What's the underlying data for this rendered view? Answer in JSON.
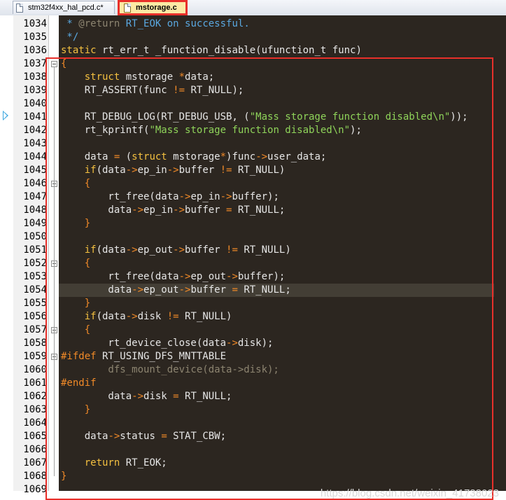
{
  "tabs": [
    {
      "label": "stm32f4xx_hal_pcd.c*",
      "active": false
    },
    {
      "label": "mstorage.c",
      "active": true
    }
  ],
  "editor": {
    "current_line": 1041,
    "highlighted_line": 1054,
    "lines": [
      {
        "num": "1034",
        "fold": false,
        "segs": [
          [
            "cmt",
            " * "
          ],
          [
            "dim",
            "@return"
          ],
          [
            "cmt",
            " RT_EOK on successful."
          ]
        ]
      },
      {
        "num": "1035",
        "fold": false,
        "segs": [
          [
            "cmt",
            " */"
          ]
        ]
      },
      {
        "num": "1036",
        "fold": false,
        "segs": [
          [
            "kw",
            "static"
          ],
          [
            "txt",
            " rt_err_t _function_disable(ufunction_t func)"
          ]
        ]
      },
      {
        "num": "1037",
        "fold": true,
        "segs": [
          [
            "op",
            "{"
          ]
        ]
      },
      {
        "num": "1038",
        "fold": false,
        "segs": [
          [
            "txt",
            "    "
          ],
          [
            "kw",
            "struct"
          ],
          [
            "txt",
            " mstorage "
          ],
          [
            "op",
            "*"
          ],
          [
            "txt",
            "data;"
          ]
        ]
      },
      {
        "num": "1039",
        "fold": false,
        "segs": [
          [
            "txt",
            "    RT_ASSERT(func "
          ],
          [
            "op",
            "!="
          ],
          [
            "txt",
            " RT_NULL);"
          ]
        ]
      },
      {
        "num": "1040",
        "fold": false,
        "segs": [
          [
            "txt",
            ""
          ]
        ]
      },
      {
        "num": "1041",
        "fold": false,
        "segs": [
          [
            "txt",
            "    RT_DEBUG_LOG(RT_DEBUG_USB, ("
          ],
          [
            "str",
            "\"Mass storage function disabled\\n\""
          ],
          [
            "txt",
            "));"
          ]
        ]
      },
      {
        "num": "1042",
        "fold": false,
        "segs": [
          [
            "txt",
            "    rt_kprintf("
          ],
          [
            "str",
            "\"Mass storage function disabled\\n\""
          ],
          [
            "txt",
            ");"
          ]
        ]
      },
      {
        "num": "1043",
        "fold": false,
        "segs": [
          [
            "txt",
            ""
          ]
        ]
      },
      {
        "num": "1044",
        "fold": false,
        "segs": [
          [
            "txt",
            "    data "
          ],
          [
            "op",
            "="
          ],
          [
            "txt",
            " ("
          ],
          [
            "kw",
            "struct"
          ],
          [
            "txt",
            " mstorage"
          ],
          [
            "op",
            "*"
          ],
          [
            "txt",
            ")func"
          ],
          [
            "op",
            "->"
          ],
          [
            "txt",
            "user_data;"
          ]
        ]
      },
      {
        "num": "1045",
        "fold": false,
        "segs": [
          [
            "txt",
            "    "
          ],
          [
            "kw",
            "if"
          ],
          [
            "txt",
            "(data"
          ],
          [
            "op",
            "->"
          ],
          [
            "txt",
            "ep_in"
          ],
          [
            "op",
            "->"
          ],
          [
            "txt",
            "buffer "
          ],
          [
            "op",
            "!="
          ],
          [
            "txt",
            " RT_NULL)"
          ]
        ]
      },
      {
        "num": "1046",
        "fold": true,
        "segs": [
          [
            "txt",
            "    "
          ],
          [
            "op",
            "{"
          ]
        ]
      },
      {
        "num": "1047",
        "fold": false,
        "segs": [
          [
            "txt",
            "        rt_free(data"
          ],
          [
            "op",
            "->"
          ],
          [
            "txt",
            "ep_in"
          ],
          [
            "op",
            "->"
          ],
          [
            "txt",
            "buffer);"
          ]
        ]
      },
      {
        "num": "1048",
        "fold": false,
        "segs": [
          [
            "txt",
            "        data"
          ],
          [
            "op",
            "->"
          ],
          [
            "txt",
            "ep_in"
          ],
          [
            "op",
            "->"
          ],
          [
            "txt",
            "buffer "
          ],
          [
            "op",
            "="
          ],
          [
            "txt",
            " RT_NULL;"
          ]
        ]
      },
      {
        "num": "1049",
        "fold": false,
        "segs": [
          [
            "txt",
            "    "
          ],
          [
            "op",
            "}"
          ]
        ]
      },
      {
        "num": "1050",
        "fold": false,
        "segs": [
          [
            "txt",
            ""
          ]
        ]
      },
      {
        "num": "1051",
        "fold": false,
        "segs": [
          [
            "txt",
            "    "
          ],
          [
            "kw",
            "if"
          ],
          [
            "txt",
            "(data"
          ],
          [
            "op",
            "->"
          ],
          [
            "txt",
            "ep_out"
          ],
          [
            "op",
            "->"
          ],
          [
            "txt",
            "buffer "
          ],
          [
            "op",
            "!="
          ],
          [
            "txt",
            " RT_NULL)"
          ]
        ]
      },
      {
        "num": "1052",
        "fold": true,
        "segs": [
          [
            "txt",
            "    "
          ],
          [
            "op",
            "{"
          ]
        ]
      },
      {
        "num": "1053",
        "fold": false,
        "segs": [
          [
            "txt",
            "        rt_free(data"
          ],
          [
            "op",
            "->"
          ],
          [
            "txt",
            "ep_out"
          ],
          [
            "op",
            "->"
          ],
          [
            "txt",
            "buffer);"
          ]
        ]
      },
      {
        "num": "1054",
        "fold": false,
        "segs": [
          [
            "txt",
            "        data"
          ],
          [
            "op",
            "->"
          ],
          [
            "txt",
            "ep_out"
          ],
          [
            "op",
            "->"
          ],
          [
            "txt",
            "buffer "
          ],
          [
            "op",
            "="
          ],
          [
            "txt",
            " RT_NULL;"
          ]
        ]
      },
      {
        "num": "1055",
        "fold": false,
        "segs": [
          [
            "txt",
            "    "
          ],
          [
            "op",
            "}"
          ]
        ]
      },
      {
        "num": "1056",
        "fold": false,
        "segs": [
          [
            "txt",
            "    "
          ],
          [
            "kw",
            "if"
          ],
          [
            "txt",
            "(data"
          ],
          [
            "op",
            "->"
          ],
          [
            "txt",
            "disk "
          ],
          [
            "op",
            "!="
          ],
          [
            "txt",
            " RT_NULL)"
          ]
        ]
      },
      {
        "num": "1057",
        "fold": true,
        "segs": [
          [
            "txt",
            "    "
          ],
          [
            "op",
            "{"
          ]
        ]
      },
      {
        "num": "1058",
        "fold": false,
        "segs": [
          [
            "txt",
            "        rt_device_close(data"
          ],
          [
            "op",
            "->"
          ],
          [
            "txt",
            "disk);"
          ]
        ]
      },
      {
        "num": "1059",
        "fold": true,
        "segs": [
          [
            "pp",
            "#ifdef"
          ],
          [
            "txt",
            " RT_USING_DFS_MNTTABLE"
          ]
        ]
      },
      {
        "num": "1060",
        "fold": false,
        "segs": [
          [
            "dim",
            "        dfs_mount_device(data->disk);"
          ]
        ]
      },
      {
        "num": "1061",
        "fold": false,
        "segs": [
          [
            "pp",
            "#endif"
          ]
        ]
      },
      {
        "num": "1062",
        "fold": false,
        "segs": [
          [
            "txt",
            "        data"
          ],
          [
            "op",
            "->"
          ],
          [
            "txt",
            "disk "
          ],
          [
            "op",
            "="
          ],
          [
            "txt",
            " RT_NULL;"
          ]
        ]
      },
      {
        "num": "1063",
        "fold": false,
        "segs": [
          [
            "txt",
            "    "
          ],
          [
            "op",
            "}"
          ]
        ]
      },
      {
        "num": "1064",
        "fold": false,
        "segs": [
          [
            "txt",
            ""
          ]
        ]
      },
      {
        "num": "1065",
        "fold": false,
        "segs": [
          [
            "txt",
            "    data"
          ],
          [
            "op",
            "->"
          ],
          [
            "txt",
            "status "
          ],
          [
            "op",
            "="
          ],
          [
            "txt",
            " STAT_CBW;"
          ]
        ]
      },
      {
        "num": "1066",
        "fold": false,
        "segs": [
          [
            "txt",
            ""
          ]
        ]
      },
      {
        "num": "1067",
        "fold": false,
        "segs": [
          [
            "txt",
            "    "
          ],
          [
            "kw",
            "return"
          ],
          [
            "txt",
            " RT_EOK;"
          ]
        ]
      },
      {
        "num": "1068",
        "fold": false,
        "segs": [
          [
            "op",
            "}"
          ]
        ]
      },
      {
        "num": "1069",
        "fold": false,
        "segs": [
          [
            "txt",
            ""
          ]
        ]
      }
    ]
  },
  "watermark": "https://blog.csdn.net/weixin_41738023",
  "colors": {
    "editor_bg": "#2c2620",
    "comment": "#5aa8e0",
    "keyword": "#f4c040",
    "string": "#8fd45a",
    "operator": "#f18a28",
    "highlight_box": "#e8302a"
  }
}
